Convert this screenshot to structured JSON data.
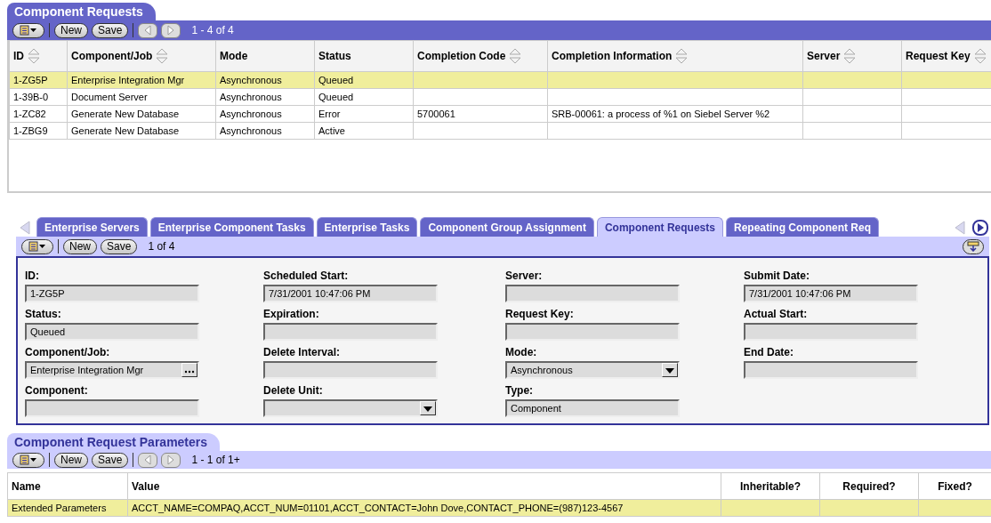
{
  "requests_list": {
    "title": "Component Requests",
    "toolbar": {
      "buttons": [
        "New",
        "Save"
      ],
      "record_count": "1 - 4 of 4"
    },
    "columns": [
      {
        "label": "ID",
        "sortable": true
      },
      {
        "label": "Component/Job",
        "sortable": true
      },
      {
        "label": "Mode",
        "sortable": false
      },
      {
        "label": "Status",
        "sortable": false
      },
      {
        "label": "Completion Code",
        "sortable": true
      },
      {
        "label": "Completion Information",
        "sortable": true
      },
      {
        "label": "Server",
        "sortable": true
      },
      {
        "label": "Request Key",
        "sortable": true
      }
    ],
    "rows": [
      {
        "selected": true,
        "cells": [
          "1-ZG5P",
          "Enterprise Integration Mgr",
          "Asynchronous",
          "Queued",
          null,
          null,
          null,
          null
        ]
      },
      {
        "selected": false,
        "cells": [
          "1-39B-0",
          "Document Server",
          "Asynchronous",
          "Queued",
          null,
          null,
          null,
          null
        ]
      },
      {
        "selected": false,
        "cells": [
          "1-ZC82",
          "Generate New Database",
          "Asynchronous",
          "Error",
          "5700061",
          "SRB-00061: a process of %1 on Siebel Server %2",
          null,
          null
        ]
      },
      {
        "selected": false,
        "cells": [
          "1-ZBG9",
          "Generate New Database",
          "Asynchronous",
          "Active",
          null,
          null,
          null,
          null
        ]
      }
    ]
  },
  "detail": {
    "tabs": [
      {
        "label": "Enterprise Servers",
        "selected": false
      },
      {
        "label": "Enterprise Component Tasks",
        "selected": false
      },
      {
        "label": "Enterprise Tasks",
        "selected": false
      },
      {
        "label": "Component Group Assignment",
        "selected": false
      },
      {
        "label": "Component Requests",
        "selected": true
      },
      {
        "label": "Repeating Component Req",
        "selected": false
      }
    ],
    "toolbar": {
      "buttons": [
        "New",
        "Save"
      ],
      "record_count": "1 of 4"
    },
    "form_columns": [
      [
        {
          "label": "ID:",
          "value": "1-ZG5P",
          "kind": "text"
        },
        {
          "label": "Status:",
          "value": "Queued",
          "kind": "text"
        },
        {
          "label": "Component/Job:",
          "value": "Enterprise Integration Mgr",
          "kind": "picker"
        },
        {
          "label": "Component:",
          "kind": "text"
        }
      ],
      [
        {
          "label": "Scheduled Start:",
          "value": "7/31/2001 10:47:06 PM",
          "kind": "text"
        },
        {
          "label": "Expiration:",
          "kind": "text"
        },
        {
          "label": "Delete Interval:",
          "kind": "text"
        },
        {
          "label": "Delete Unit:",
          "kind": "dropdown"
        }
      ],
      [
        {
          "label": "Server:",
          "kind": "text"
        },
        {
          "label": "Request Key:",
          "kind": "text"
        },
        {
          "label": "Mode:",
          "value": "Asynchronous",
          "kind": "dropdown"
        },
        {
          "label": "Type:",
          "value": "Component",
          "kind": "text"
        }
      ],
      [
        {
          "label": "Submit Date:",
          "value": "7/31/2001 10:47:06 PM",
          "kind": "text"
        },
        {
          "label": "Actual Start:",
          "kind": "text"
        },
        {
          "label": "End Date:",
          "kind": "text"
        }
      ]
    ]
  },
  "parameters_list": {
    "title": "Component Request Parameters",
    "toolbar": {
      "buttons": [
        "New",
        "Save"
      ],
      "record_count": "1 - 1 of 1+"
    },
    "columns": [
      {
        "label": "Name",
        "sortable": false
      },
      {
        "label": "Value",
        "sortable": false
      },
      {
        "label": "Inheritable?",
        "sortable": false
      },
      {
        "label": "Required?",
        "sortable": false
      },
      {
        "label": "Fixed?",
        "sortable": false
      }
    ],
    "rows": [
      {
        "selected": true,
        "cells": [
          "Extended Parameters",
          "ACCT_NAME=COMPAQ,ACCT_NUM=01101,ACCT_CONTACT=John Dove,CONTACT_PHONE=(987)123-4567",
          null,
          null,
          null
        ]
      }
    ]
  }
}
